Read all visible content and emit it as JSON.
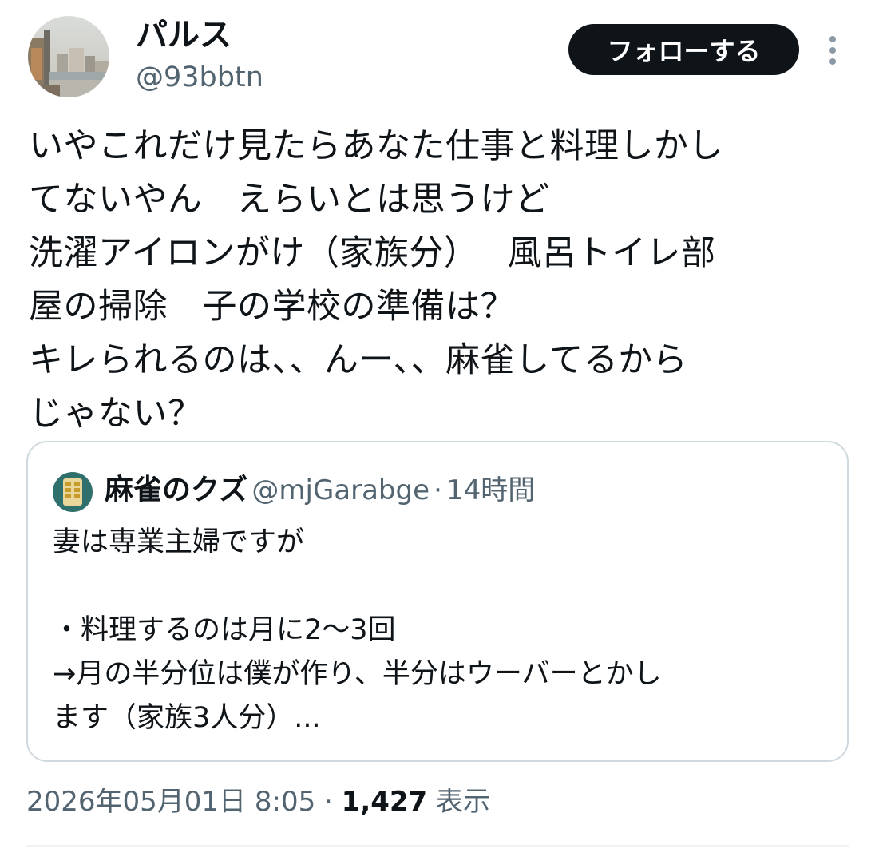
{
  "author": {
    "display_name": "パルス",
    "handle": "@93bbtn"
  },
  "follow_label": "フォローする",
  "more_icon": "more-vertical-icon",
  "tweet_text": "いやこれだけ見たらあなた仕事と料理しかし\nてないやん　えらいとは思うけど\n洗濯アイロンがけ（家族分）　 風呂トイレ部\n屋の掃除　子の学校の準備は？\nキレられるのは、、んー、、麻雀してるから\nじゃない？",
  "quoted": {
    "display_name": "麻雀のクズ",
    "handle": "@mjGarabge",
    "separator": "·",
    "time": "14時間",
    "text": "妻は専業主婦ですが\n\n・料理するのは月に2〜3回\n→月の半分位は僕が作り、半分はウーバーとかし\nます（家族3人分）..."
  },
  "meta": {
    "timestamp": "2026年05月01日 8:05",
    "separator": "·",
    "views_count": "1,427",
    "views_label": "表示"
  },
  "colors": {
    "text_primary": "#0f1419",
    "text_secondary": "#536471",
    "follow_bg": "#0f1419",
    "border": "#cfd9de"
  }
}
